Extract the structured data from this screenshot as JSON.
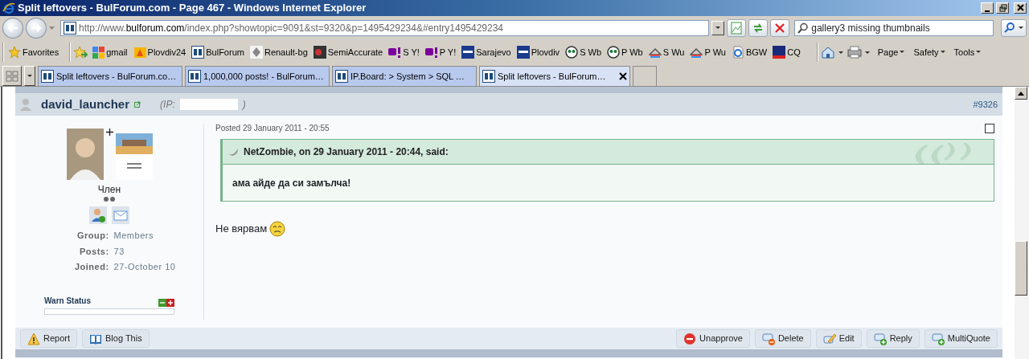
{
  "window": {
    "title": "Split leftovers - BulForum.com - Page 467 - Windows Internet Explorer"
  },
  "address_bar": {
    "url_start": "http://www.",
    "url_domain": "bulforum.com",
    "url_rest": "/index.php?showtopic=9091&st=9320&p=1495429234&#entry1495429234"
  },
  "search": {
    "value": "gallery3 missing thumbnails"
  },
  "favorites": {
    "label": "Favorites",
    "links": [
      {
        "label": "gmail",
        "kind": "squares"
      },
      {
        "label": "Plovdiv24",
        "kind": "number"
      },
      {
        "label": "BulForum",
        "kind": "bf"
      },
      {
        "label": "Renault-bg",
        "kind": "diamond"
      },
      {
        "label": "SemiAccurate",
        "kind": "disc"
      },
      {
        "label": "S Y!",
        "kind": "yahoo"
      },
      {
        "label": "P Y!",
        "kind": "yahoo"
      },
      {
        "label": "Sarajevo",
        "kind": "twc"
      },
      {
        "label": "Plovdiv",
        "kind": "twc"
      },
      {
        "label": "S Wb",
        "kind": "bug"
      },
      {
        "label": "P Wb",
        "kind": "bug"
      },
      {
        "label": "S Wu",
        "kind": "roof"
      },
      {
        "label": "P Wu",
        "kind": "roof"
      },
      {
        "label": "BGW",
        "kind": "page"
      },
      {
        "label": "CQ",
        "kind": "cq"
      }
    ]
  },
  "command_bar": [
    {
      "label": "Page"
    },
    {
      "label": "Safety"
    },
    {
      "label": "Tools"
    }
  ],
  "tabs": [
    {
      "label": "Split leftovers - BulForum.co…",
      "selected": false
    },
    {
      "label": "1,000,000 posts! - BulForum…",
      "selected": false
    },
    {
      "label": "IP.Board: > System > SQL …",
      "selected": false
    },
    {
      "label": "Split leftovers - BulForum…",
      "selected": true
    }
  ],
  "post": {
    "author": "david_launcher",
    "ip_label": "(IP:",
    "ip_close": ")",
    "number": "#9326",
    "posted": "Posted 29 January 2011 - 20:55",
    "checked": false,
    "quote": {
      "citation": "NetZombie, on 29 January 2011 - 20:44, said:",
      "text": "ама айде да си замълча!"
    },
    "body": "Не вярвам"
  },
  "author_info": {
    "title": "Член",
    "details": [
      {
        "label": "Group:",
        "value": "Members"
      },
      {
        "label": "Posts:",
        "value": "73"
      },
      {
        "label": "Joined:",
        "value": "27-October 10"
      }
    ],
    "warn": {
      "label": "Warn Status",
      "level": 0
    }
  },
  "buttons_left": [
    {
      "label": "Report",
      "kind": "report"
    },
    {
      "label": "Blog This",
      "kind": "blog"
    }
  ],
  "buttons_right": [
    {
      "label": "Unapprove",
      "kind": "unapprove"
    },
    {
      "label": "Delete",
      "kind": "delete"
    },
    {
      "label": "Edit",
      "kind": "edit"
    },
    {
      "label": "Reply",
      "kind": "reply"
    },
    {
      "label": "MultiQuote",
      "kind": "multiquote"
    }
  ]
}
